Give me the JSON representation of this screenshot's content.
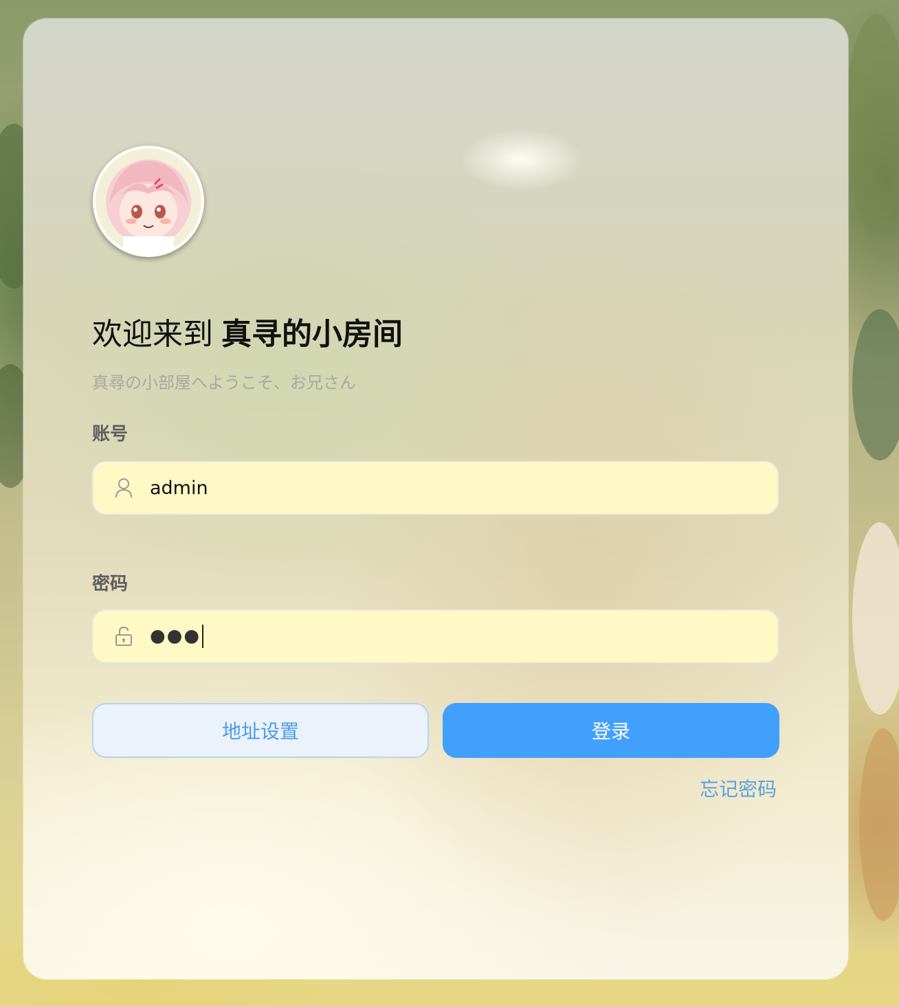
{
  "header": {
    "title_prefix": "欢迎来到",
    "title_name": "真寻的小房间",
    "subtitle": "真尋の小部屋へようこそ、お兄さん"
  },
  "form": {
    "account_label": "账号",
    "account_value": "admin",
    "password_label": "密码",
    "password_masked": "●●●"
  },
  "actions": {
    "address_settings": "地址设置",
    "login": "登录",
    "forgot_password": "忘记密码"
  },
  "icons": {
    "account": "user-icon",
    "password": "unlock-icon"
  },
  "colors": {
    "primary": "#42a0fd",
    "input_bg": "#fff9c6",
    "link": "#56a2e6"
  }
}
